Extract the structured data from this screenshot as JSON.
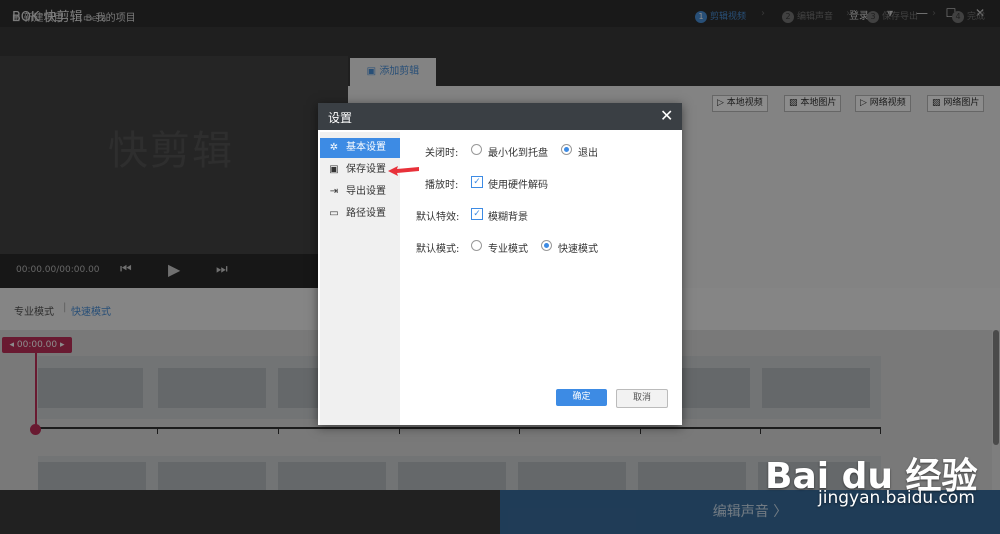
{
  "app": {
    "logo_text": "BOK 快剪辑",
    "beta": "Beta",
    "login": "登录",
    "icons": [
      "menu-icon",
      "minimize-icon",
      "maximize-icon",
      "close-icon"
    ]
  },
  "toolbar": {
    "new_project": "新建项目",
    "my_projects": "我的项目",
    "steps": [
      {
        "num": "1",
        "label": "剪辑视频"
      },
      {
        "num": "2",
        "label": "编辑声音"
      },
      {
        "num": "3",
        "label": "保存导出"
      },
      {
        "num": "4",
        "label": "完成"
      }
    ]
  },
  "preview": {
    "watermark": "快剪辑",
    "timecode": "00:00.00/00:00.00"
  },
  "right_panel": {
    "tab_label": "添加剪辑",
    "sources": [
      "本地视频",
      "本地图片",
      "网络视频",
      "网络图片"
    ]
  },
  "mode_bar": {
    "pro": "专业模式",
    "fast": "快速模式",
    "separator": "|"
  },
  "timeline": {
    "playhead_time": "00:00.00"
  },
  "bottom": {
    "edit_sound": "编辑声音 〉"
  },
  "dialog": {
    "title": "设置",
    "nav": [
      {
        "label": "基本设置",
        "icon": "gear-icon"
      },
      {
        "label": "保存设置",
        "icon": "save-icon"
      },
      {
        "label": "导出设置",
        "icon": "export-icon"
      },
      {
        "label": "路径设置",
        "icon": "folder-icon"
      }
    ],
    "rows": [
      {
        "label": "关闭时:",
        "options": [
          "最小化到托盘",
          "退出"
        ],
        "selected": "退出"
      },
      {
        "label": "播放时:",
        "checkbox": "使用硬件解码",
        "checked": true
      },
      {
        "label": "默认特效:",
        "checkbox": "模糊背景",
        "checked": true
      },
      {
        "label": "默认模式:",
        "options": [
          "专业模式",
          "快速模式"
        ],
        "selected": "快速模式"
      }
    ],
    "ok": "确定",
    "cancel": "取消"
  },
  "watermark": {
    "logo": "Bai du 经验",
    "url": "jingyan.baidu.com"
  },
  "colors": {
    "accent": "#3d8be4",
    "playhead": "#c0305a",
    "arrow": "#e8313a"
  }
}
